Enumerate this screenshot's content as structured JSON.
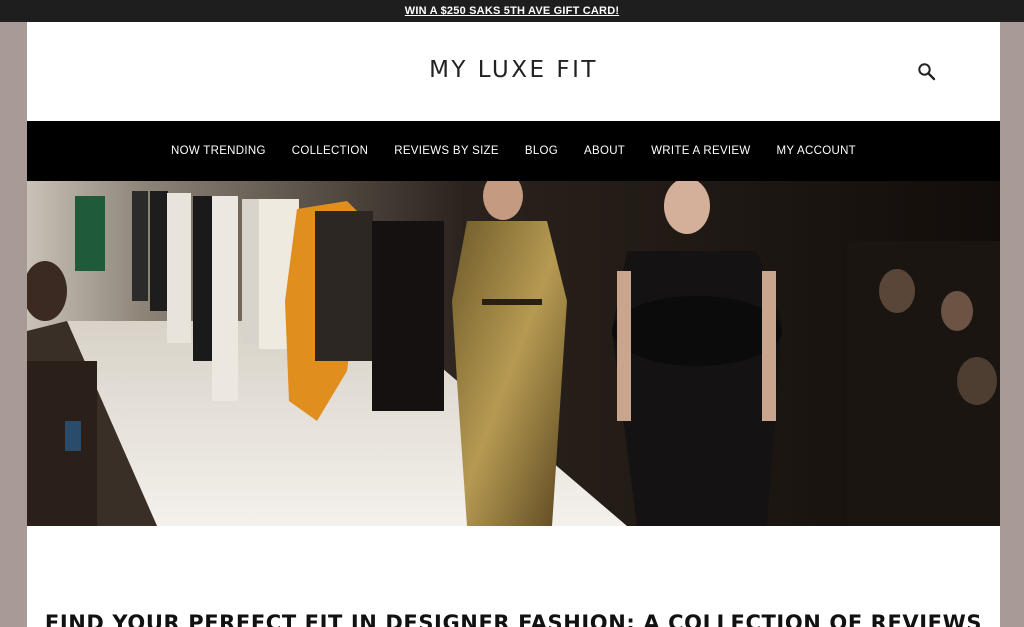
{
  "promo": {
    "text": "WIN A $250 SAKS 5TH AVE GIFT CARD!"
  },
  "header": {
    "logo": "MY LUXE FIT",
    "search_icon": "search-icon"
  },
  "nav": {
    "items": [
      {
        "label": "NOW TRENDING"
      },
      {
        "label": "COLLECTION"
      },
      {
        "label": "REVIEWS BY SIZE"
      },
      {
        "label": "BLOG"
      },
      {
        "label": "ABOUT"
      },
      {
        "label": "WRITE A REVIEW"
      },
      {
        "label": "MY ACCOUNT"
      }
    ]
  },
  "hero": {
    "image": "runway-fashion-show-photo"
  },
  "main": {
    "headline": "FIND YOUR PERFECT FIT IN DESIGNER FASHION: A COLLECTION OF REVIEWS"
  },
  "colors": {
    "promo_bg": "#1e1e1e",
    "nav_bg": "#000000",
    "side_bg": "#a89b95"
  }
}
